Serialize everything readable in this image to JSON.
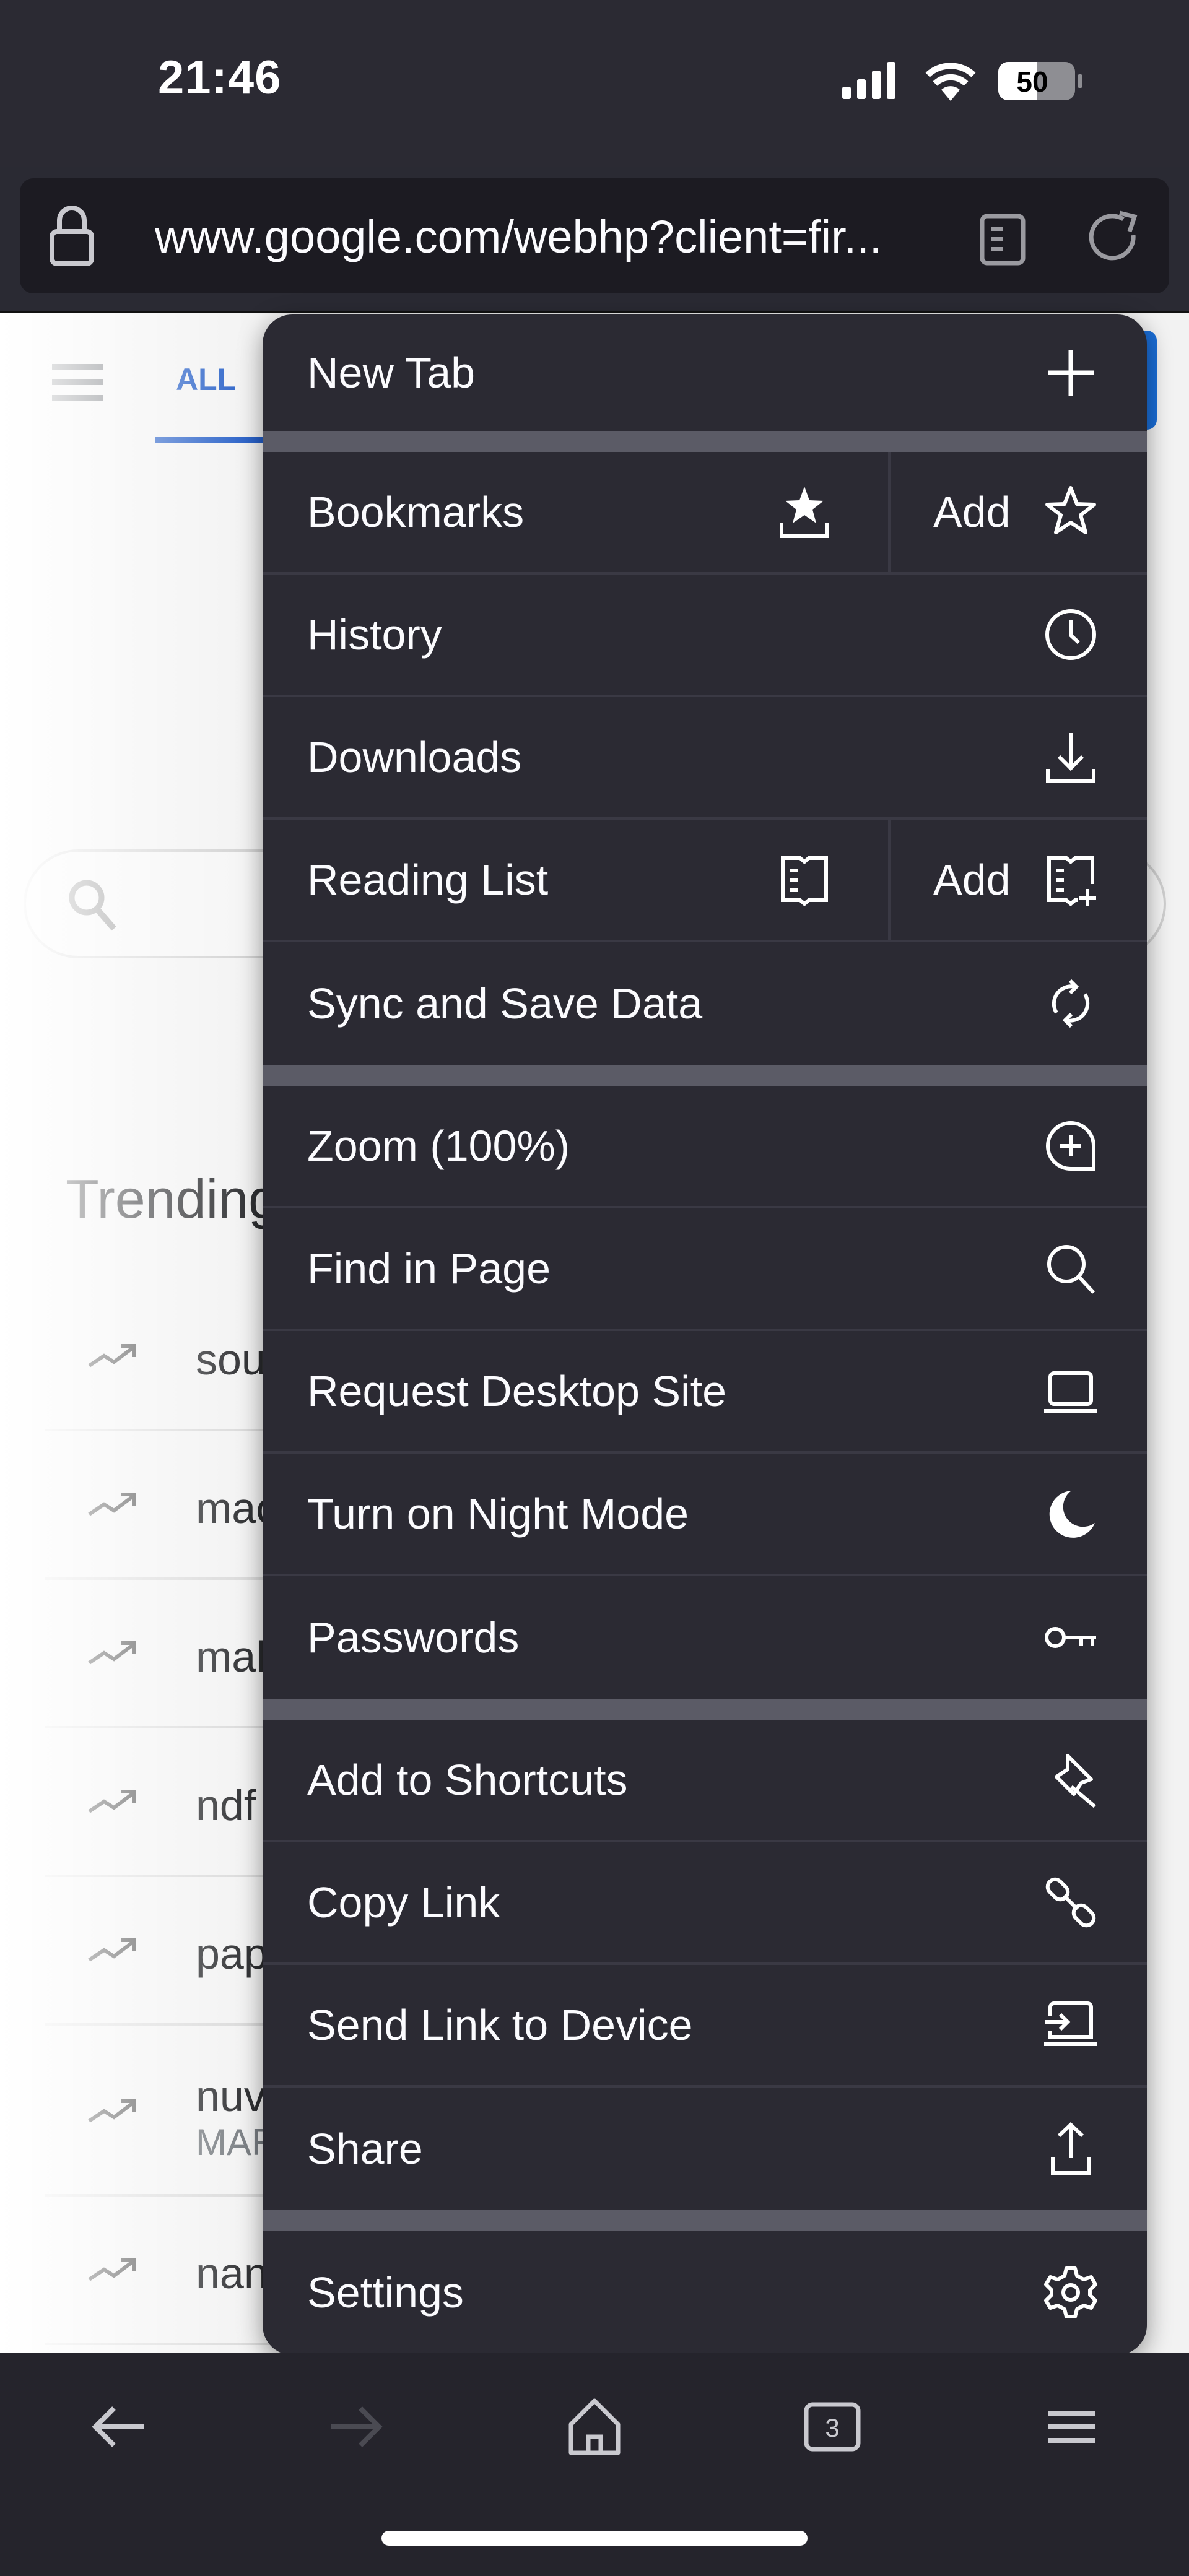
{
  "status_bar": {
    "time": "21:46",
    "battery": "50",
    "signal_icon": "cellular-signal-icon",
    "wifi_icon": "wifi-icon"
  },
  "url_bar": {
    "url": "www.google.com/webhp?client=fir...",
    "lock_icon": "lock-icon",
    "reader_icon": "reader-mode-icon",
    "reload_icon": "reload-icon"
  },
  "page": {
    "tab_all": "ALL",
    "trending_title": "Trending",
    "trending": [
      {
        "query": "sou",
        "sub": ""
      },
      {
        "query": "mac",
        "sub": ""
      },
      {
        "query": "mal",
        "sub": ""
      },
      {
        "query": "ndf",
        "sub": ""
      },
      {
        "query": "pap",
        "sub": ""
      },
      {
        "query": "nuv",
        "sub": "MAR"
      },
      {
        "query": "nan",
        "sub": ""
      }
    ]
  },
  "menu": {
    "new_tab": {
      "label": "New Tab",
      "icon": "plus-icon"
    },
    "bookmarks": {
      "label": "Bookmarks",
      "icon": "bookmarks-tray-icon",
      "add_label": "Add",
      "add_icon": "star-outline-icon"
    },
    "history": {
      "label": "History",
      "icon": "clock-icon"
    },
    "downloads": {
      "label": "Downloads",
      "icon": "download-icon"
    },
    "reading_list": {
      "label": "Reading List",
      "icon": "reading-list-icon",
      "add_label": "Add",
      "add_icon": "reading-list-add-icon"
    },
    "sync": {
      "label": "Sync and Save Data",
      "icon": "sync-icon"
    },
    "zoom": {
      "label": "Zoom (100%)",
      "icon": "zoom-plus-icon"
    },
    "find": {
      "label": "Find in Page",
      "icon": "search-icon"
    },
    "desktop": {
      "label": "Request Desktop Site",
      "icon": "laptop-icon"
    },
    "night": {
      "label": "Turn on Night Mode",
      "icon": "moon-icon"
    },
    "passwords": {
      "label": "Passwords",
      "icon": "key-icon"
    },
    "shortcuts": {
      "label": "Add to Shortcuts",
      "icon": "pin-icon"
    },
    "copy_link": {
      "label": "Copy Link",
      "icon": "link-icon"
    },
    "send_link": {
      "label": "Send Link to Device",
      "icon": "send-to-device-icon"
    },
    "share": {
      "label": "Share",
      "icon": "share-icon"
    },
    "settings": {
      "label": "Settings",
      "icon": "gear-icon"
    }
  },
  "toolbar": {
    "tab_count": "3"
  },
  "colors": {
    "menu_bg": "#2b2a33",
    "separator": "#5b5b66",
    "accent": "#1a56c4"
  }
}
